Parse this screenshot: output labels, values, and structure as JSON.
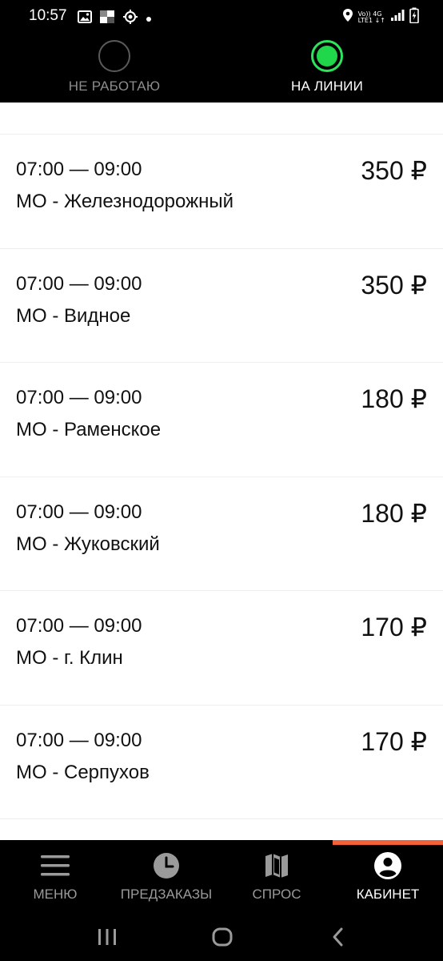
{
  "status_bar": {
    "time": "10:57",
    "network_top": "Vo)) 4G",
    "network_bottom": "LTE1 ↓↑"
  },
  "work_status": {
    "off_label": "НЕ РАБОТАЮ",
    "on_label": "НА ЛИНИИ",
    "active": "on",
    "active_color": "#20d64a"
  },
  "orders": [
    {
      "time": "07:00 — 09:00",
      "place": "МО - Железнодорожный",
      "price": "350 ₽"
    },
    {
      "time": "07:00 — 09:00",
      "place": "МО - Видное",
      "price": "350 ₽"
    },
    {
      "time": "07:00 — 09:00",
      "place": "МО - Раменское",
      "price": "180 ₽"
    },
    {
      "time": "07:00 — 09:00",
      "place": "МО - Жуковский",
      "price": "180 ₽"
    },
    {
      "time": "07:00 — 09:00",
      "place": "МО - г. Клин",
      "price": "170 ₽"
    },
    {
      "time": "07:00 — 09:00",
      "place": "МО - Серпухов",
      "price": "170 ₽"
    }
  ],
  "tabs": [
    {
      "label": "МЕНЮ",
      "icon": "menu-icon"
    },
    {
      "label": "ПРЕДЗАКАЗЫ",
      "icon": "clock-icon"
    },
    {
      "label": "СПРОС",
      "icon": "map-icon"
    },
    {
      "label": "КАБИНЕТ",
      "icon": "account-icon"
    }
  ],
  "active_tab": "КАБИНЕТ",
  "accent_color": "#f2613a"
}
